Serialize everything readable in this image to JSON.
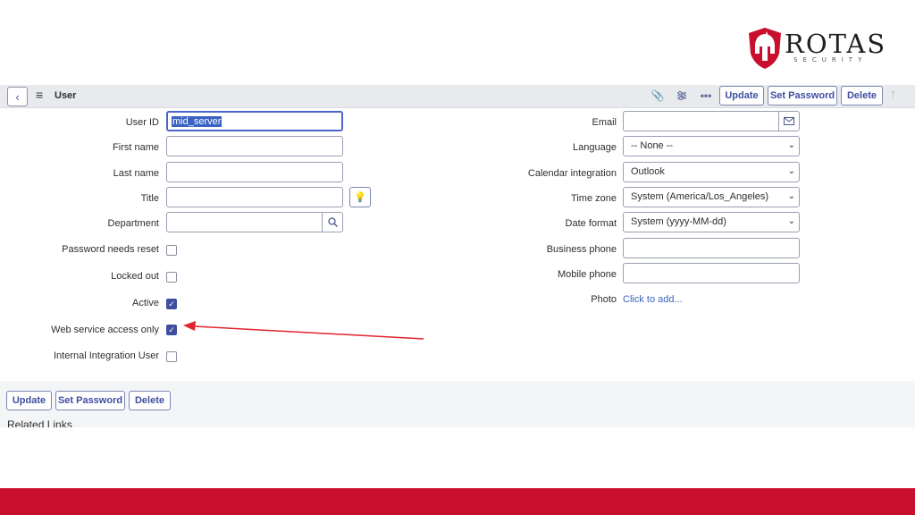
{
  "brand": {
    "name": "ROTAS",
    "tagline": "SECURITY",
    "accent": "#c8102e"
  },
  "header": {
    "title": "User",
    "buttons": {
      "update": "Update",
      "set_password": "Set Password",
      "delete": "Delete"
    },
    "icons": [
      "back-chevron-icon",
      "hamburger-menu-icon",
      "paperclip-icon",
      "settings-sliders-icon",
      "more-dots-icon",
      "scroll-up-arrow-icon"
    ]
  },
  "form": {
    "left": {
      "user_id": {
        "label": "User ID",
        "value": "mid_server"
      },
      "first_name": {
        "label": "First name",
        "value": ""
      },
      "last_name": {
        "label": "Last name",
        "value": ""
      },
      "title": {
        "label": "Title",
        "value": ""
      },
      "department": {
        "label": "Department",
        "value": ""
      },
      "password_needs_reset": {
        "label": "Password needs reset",
        "checked": false
      },
      "locked_out": {
        "label": "Locked out",
        "checked": false
      },
      "active": {
        "label": "Active",
        "checked": true
      },
      "web_service_access_only": {
        "label": "Web service access only",
        "checked": true
      },
      "internal_integration_user": {
        "label": "Internal Integration User",
        "checked": false
      }
    },
    "right": {
      "email": {
        "label": "Email",
        "value": ""
      },
      "language": {
        "label": "Language",
        "value": "-- None --"
      },
      "calendar_integration": {
        "label": "Calendar integration",
        "value": "Outlook"
      },
      "time_zone": {
        "label": "Time zone",
        "value": "System (America/Los_Angeles)"
      },
      "date_format": {
        "label": "Date format",
        "value": "System (yyyy-MM-dd)"
      },
      "business_phone": {
        "label": "Business phone",
        "value": ""
      },
      "mobile_phone": {
        "label": "Mobile phone",
        "value": ""
      },
      "photo": {
        "label": "Photo",
        "link": "Click to add..."
      }
    }
  },
  "footer": {
    "buttons": {
      "update": "Update",
      "set_password": "Set Password",
      "delete": "Delete"
    },
    "related_links": "Related Links"
  },
  "annotation": {
    "color": "#e0242f"
  }
}
